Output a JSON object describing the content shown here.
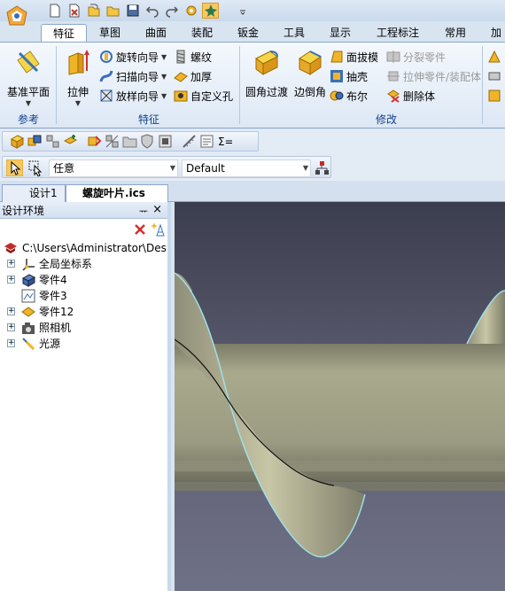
{
  "quick_access": {
    "icons": [
      "new-icon",
      "close-doc-icon",
      "new-folder-icon",
      "open-icon",
      "save-icon",
      "undo-icon",
      "redo-icon",
      "gear-icon",
      "smart-icon",
      "dropdown-icon"
    ]
  },
  "ribbon_tabs": [
    "特征",
    "草图",
    "曲面",
    "装配",
    "钣金",
    "工具",
    "显示",
    "工程标注",
    "常用",
    "加"
  ],
  "ribbon": {
    "groups": {
      "reference": "参考",
      "feature": "特征",
      "modify": "修改"
    },
    "base_plane": "基准平面",
    "extrude": "拉伸",
    "revolve_wizard": "旋转向导",
    "sweep_wizard": "扫描向导",
    "loft_wizard": "放样向导",
    "thread": "螺纹",
    "thicken": "加厚",
    "custom_hole": "自定义孔",
    "fillet": "圆角过渡",
    "chamfer": "边倒角",
    "draft": "面拔模",
    "shell": "抽壳",
    "boolean": "布尔",
    "split_part": "分裂零件",
    "stretch_part": "拉伸零件/装配体",
    "delete_body": "删除体"
  },
  "toolbar2": {
    "filter_value": "任意",
    "config_value": "Default"
  },
  "doc_tabs": {
    "design1": "设计1",
    "active_doc": "螺旋叶片.ics",
    "close_symbol": "×"
  },
  "panel": {
    "title": "设计环境",
    "pin_symbol": "ᅲ",
    "close_symbol": "×"
  },
  "tree": {
    "root": "C:\\Users\\Administrator\\Des",
    "items": [
      "全局坐标系",
      "零件4",
      "零件3",
      "零件12",
      "照相机",
      "光源"
    ]
  },
  "colors": {
    "ribbon_label": "#15428b",
    "active_tab_border": "#8ba7cc",
    "viewport_bg_top": "#3b3e4e",
    "viewport_bg_bottom": "#6f7186",
    "part_shaft": "#a9a98d",
    "part_blade": "#c7c6a6"
  }
}
